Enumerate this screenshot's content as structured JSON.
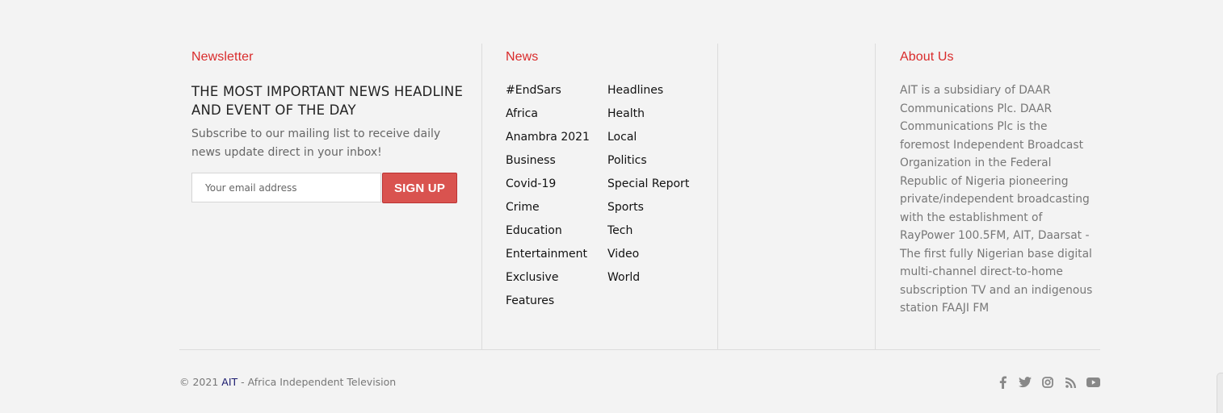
{
  "newsletter": {
    "title": "Newsletter",
    "headline": "THE MOST IMPORTANT NEWS HEADLINE AND EVENT OF THE DAY",
    "description": "Subscribe to our mailing list to receive daily news update direct in your inbox!",
    "email_placeholder": "Your email address",
    "email_value": "",
    "signup_label": "SIGN UP"
  },
  "news": {
    "title": "News",
    "left_items": [
      "#EndSars",
      "Africa",
      "Anambra 2021",
      "Business",
      "Covid-19",
      "Crime",
      "Education",
      "Entertainment",
      "Exclusive",
      "Features"
    ],
    "right_items": [
      "Headlines",
      "Health",
      "Local",
      "Politics",
      "Special Report",
      "Sports",
      "Tech",
      "Video",
      "World"
    ]
  },
  "about": {
    "title": "About Us",
    "text": "AIT is a subsidiary of DAAR Communications Plc. DAAR Communications Plc is the foremost Independent Broadcast Organization in the Federal Republic of Nigeria pioneering private/independent broadcasting with the establishment of RayPower 100.5FM, AIT, Daarsat - The first fully Nigerian base digital multi-channel direct-to-home subscription TV and an indigenous station FAAJI FM"
  },
  "footer": {
    "copyright_prefix": "© 2021 ",
    "brand": "AIT",
    "copyright_suffix": " - Africa Independent Television",
    "socials": [
      "facebook-icon",
      "twitter-icon",
      "instagram-icon",
      "rss-icon",
      "youtube-icon"
    ]
  },
  "colors": {
    "accent": "#d92b2b",
    "button": "#d9534f",
    "background": "#f3f3f3"
  }
}
